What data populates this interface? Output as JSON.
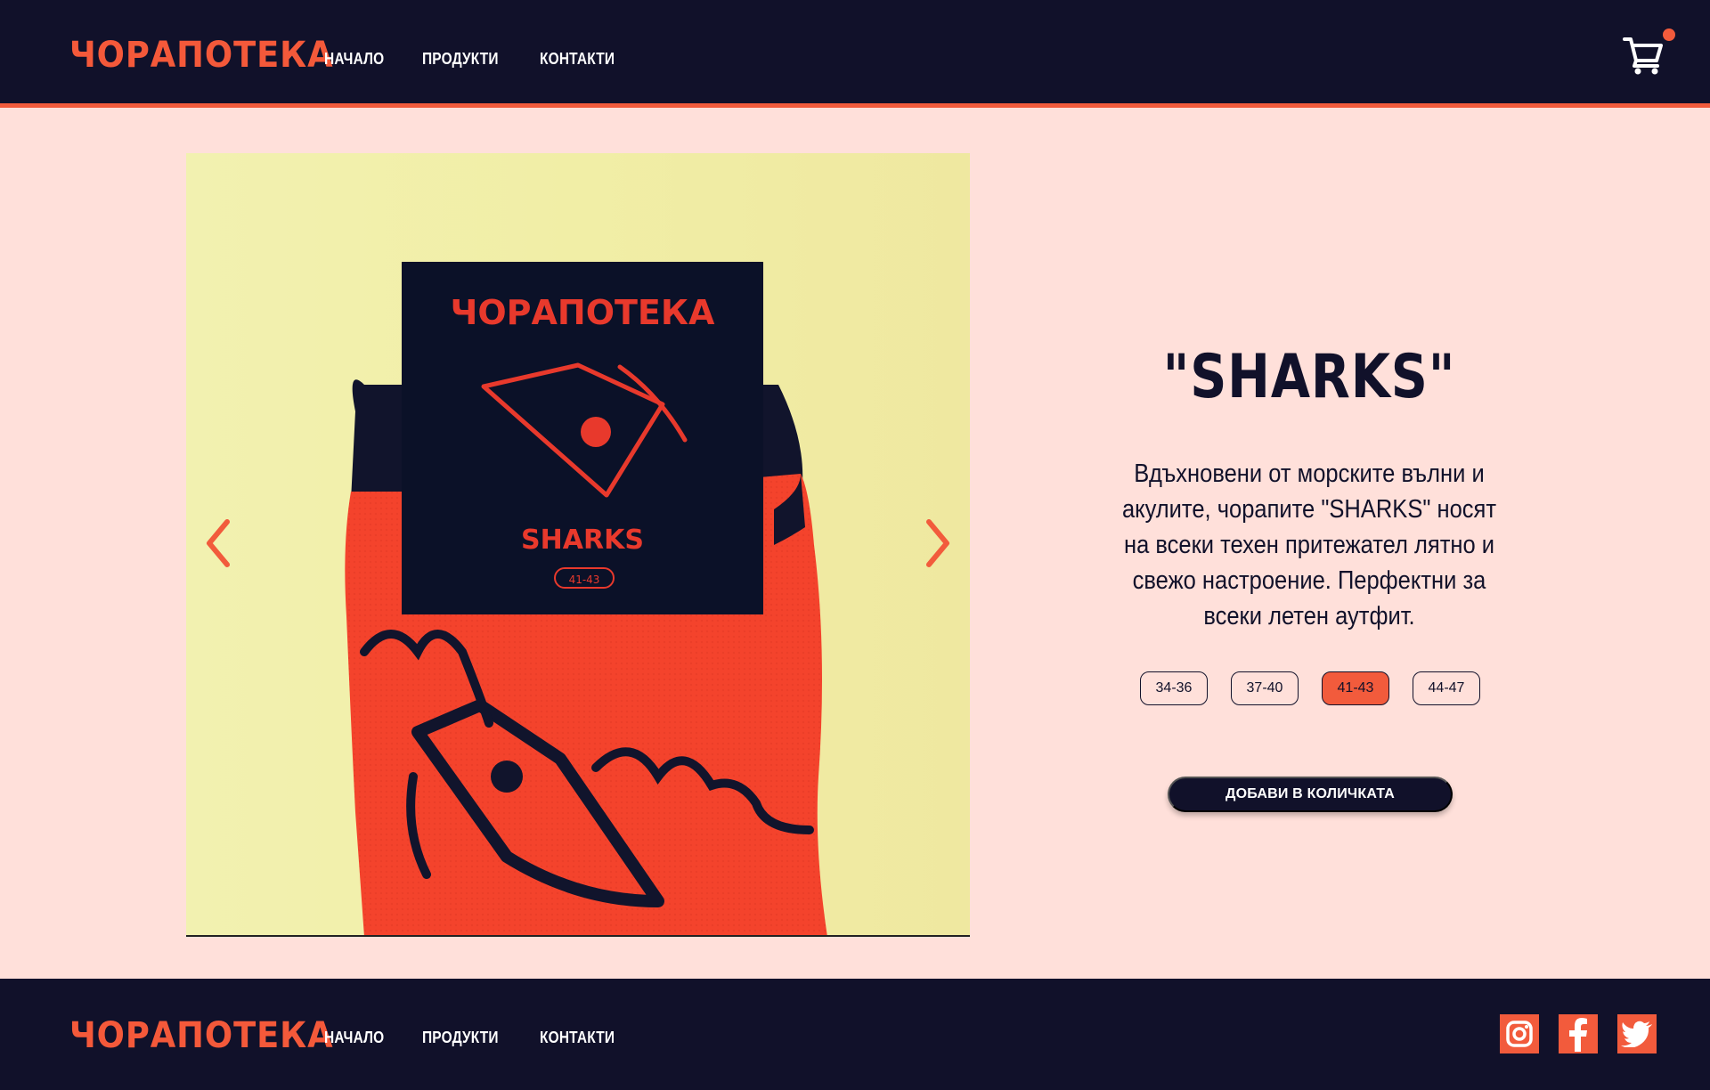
{
  "brand": {
    "logo_text": "ЧОРАПОТЕКА",
    "accent_color": "#f25b3c",
    "dark_color": "#11112a",
    "background_color": "#ffe0da"
  },
  "header": {
    "nav": [
      {
        "label": "НАЧАЛО"
      },
      {
        "label": "ПРОДУКТИ"
      },
      {
        "label": "КОНТАКТИ"
      }
    ],
    "cart_icon": "cart-icon",
    "cart_badge": "notification-dot"
  },
  "product": {
    "title": "\"SHARKS\"",
    "description": "Вдъхновени от морските вълни и акулите, чорапите \"SHARKS\" носят на всеки техен притежател лятно и свежо настроение. Перфектни за всеки летен аутфит.",
    "image": {
      "package_brand": "ЧОРАПОТЕКА",
      "package_name": "SHARKS",
      "package_size": "41-43"
    },
    "sizes": [
      {
        "label": "34-36",
        "selected": false
      },
      {
        "label": "37-40",
        "selected": false
      },
      {
        "label": "41-43",
        "selected": true
      },
      {
        "label": "44-47",
        "selected": false
      }
    ],
    "add_to_cart_label": "ДОБАВИ В КОЛИЧКАТА",
    "prev_icon": "chevron-left-icon",
    "next_icon": "chevron-right-icon"
  },
  "footer": {
    "logo_text": "ЧОРАПОТЕКА",
    "nav": [
      {
        "label": "НАЧАЛО"
      },
      {
        "label": "ПРОДУКТИ"
      },
      {
        "label": "КОНТАКТИ"
      }
    ],
    "social": [
      "instagram-icon",
      "facebook-icon",
      "twitter-icon"
    ]
  }
}
